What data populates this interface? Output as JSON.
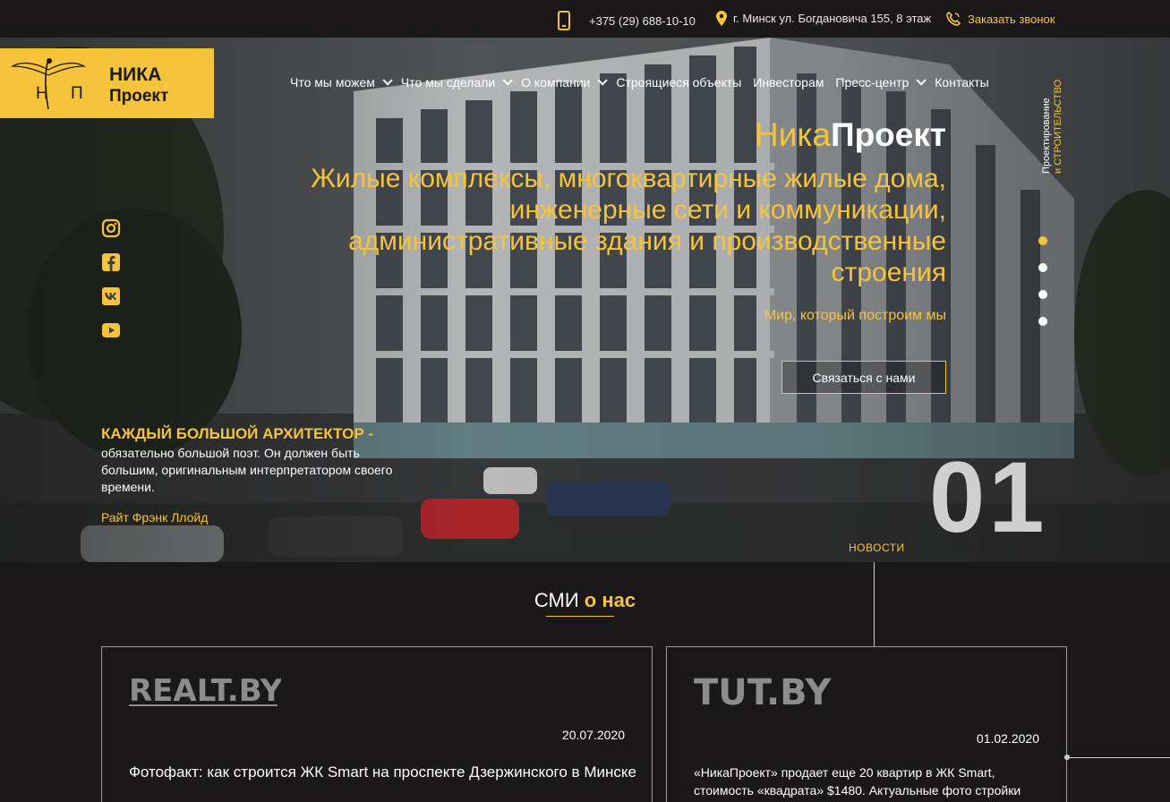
{
  "topbar": {
    "phone": "+375 (29) 688-10-10",
    "address": "г. Минск ул. Богдановича 155, 8 этаж",
    "callback": "Заказать звонок",
    "phone_icon": "smartphone-icon",
    "address_icon": "location-pin-icon",
    "callback_icon": "phone-call-icon"
  },
  "logo": {
    "monogram": "Н П",
    "name_line1": "НИКА",
    "name_line2": "Проект"
  },
  "nav": {
    "items": [
      {
        "label": "Что мы можем",
        "dropdown": true
      },
      {
        "label": "Что мы сделали",
        "dropdown": true
      },
      {
        "label": "О компании",
        "dropdown": true
      },
      {
        "label": "Строящиеся объекты",
        "dropdown": false
      },
      {
        "label": "Инвесторам",
        "dropdown": false
      },
      {
        "label": "Пресс-центр",
        "dropdown": true
      },
      {
        "label": "Контакты",
        "dropdown": false
      }
    ]
  },
  "vertical_tagline": {
    "line1": "Проектирование",
    "line2": "и СТРОИТЕЛЬСТВО"
  },
  "hero": {
    "title_light": "Ника",
    "title_bold": "Проект",
    "subtitle": "Жилые комплексы, многоквартирные жилые дома, инженерные сети и коммуникации, административные здания и производственные строения",
    "motto": "Мир, который построим мы",
    "cta": "Связаться с нами",
    "slide_number": "01",
    "news_link": "НОВОСТИ"
  },
  "slider": {
    "count": 4,
    "active_index": 0
  },
  "social": [
    "instagram-icon",
    "facebook-icon",
    "vk-icon",
    "youtube-icon"
  ],
  "quote": {
    "title": "КАЖДЫЙ БОЛЬШОЙ АРХИТЕКТОР -",
    "body": "обязательно большой поэт. Он должен быть большим, оригинальным интерпретатором своего времени.",
    "author": "Райт Фрэнк Ллойд"
  },
  "media": {
    "title_plain": "СМИ",
    "title_accent": "о нас",
    "cards": [
      {
        "source": "REALT.BY",
        "date": "20.07.2020",
        "text": "Фотофакт: как строится ЖК Smart на проспекте Дзержинского в Минске"
      },
      {
        "source": "TUT.BY",
        "date": "01.02.2020",
        "text": "«НикаПроект» продает еще 20 квартир в ЖК Smart, стоимость «квадрата» $1480. Актуальные фото стройки"
      }
    ]
  },
  "colors": {
    "accent": "#f6c33c",
    "background": "#1a1819",
    "text": "#ffffff"
  }
}
